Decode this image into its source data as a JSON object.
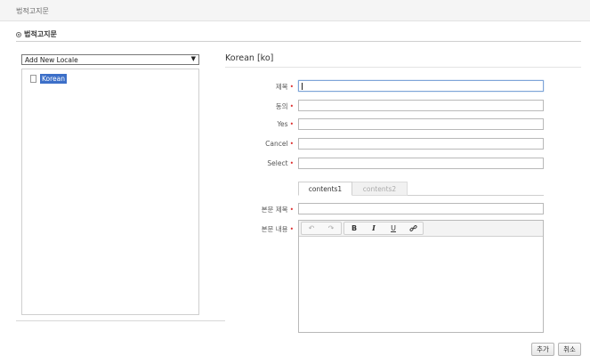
{
  "header": {
    "breadcrumb": "법적고지문"
  },
  "section": {
    "title": "법적고지문"
  },
  "locale_select": {
    "selected": "Add New Locale"
  },
  "tree": {
    "items": [
      {
        "label": "Korean"
      }
    ]
  },
  "detail": {
    "title": "Korean [ko]"
  },
  "form": {
    "required_mark": "•",
    "fields": [
      {
        "label": "제목",
        "value": ""
      },
      {
        "label": "동의",
        "value": ""
      },
      {
        "label": "Yes",
        "value": ""
      },
      {
        "label": "Cancel",
        "value": ""
      },
      {
        "label": "Select",
        "value": ""
      }
    ],
    "tabs": [
      "contents1",
      "contents2"
    ],
    "body_title_label": "본문 제목",
    "body_content_label": "본문 내용"
  },
  "editor_toolbar": {
    "undo": "↶",
    "redo": "↷",
    "bold": "B",
    "italic": "I",
    "underline": "U",
    "link": "🔗"
  },
  "actions": {
    "add": "추가",
    "cancel": "취소"
  }
}
